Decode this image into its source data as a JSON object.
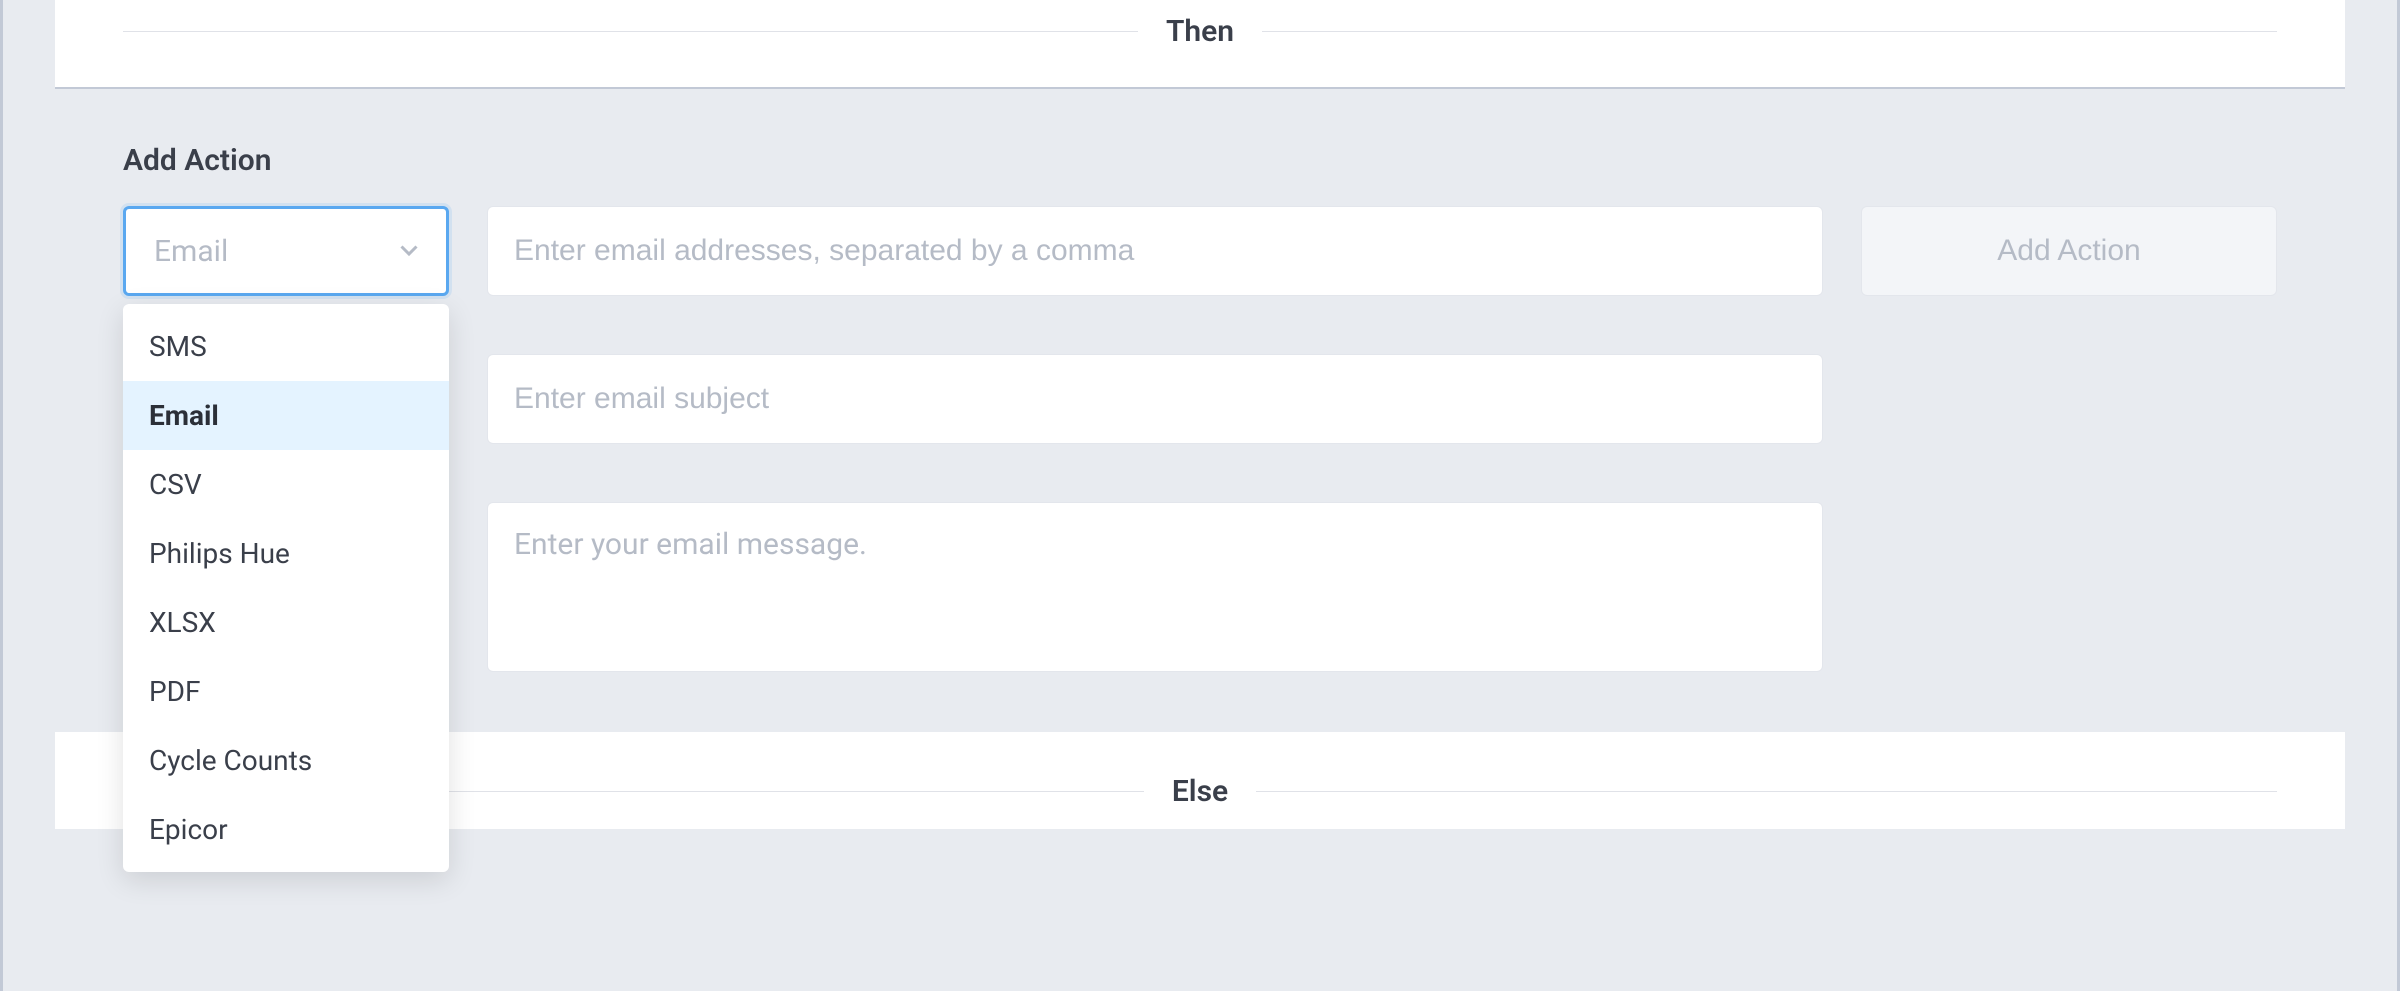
{
  "dividers": {
    "then_label": "Then",
    "else_label": "Else"
  },
  "section": {
    "title": "Add Action"
  },
  "action_type_select": {
    "value": "Email",
    "options": [
      {
        "label": "SMS",
        "selected": false
      },
      {
        "label": "Email",
        "selected": true
      },
      {
        "label": "CSV",
        "selected": false
      },
      {
        "label": "Philips Hue",
        "selected": false
      },
      {
        "label": "XLSX",
        "selected": false
      },
      {
        "label": "PDF",
        "selected": false
      },
      {
        "label": "Cycle Counts",
        "selected": false
      },
      {
        "label": "Epicor",
        "selected": false
      }
    ]
  },
  "inputs": {
    "addresses_placeholder": "Enter email addresses, separated by a comma",
    "subject_placeholder": "Enter email subject",
    "message_placeholder": "Enter your email message."
  },
  "buttons": {
    "add_action_label": "Add Action"
  }
}
